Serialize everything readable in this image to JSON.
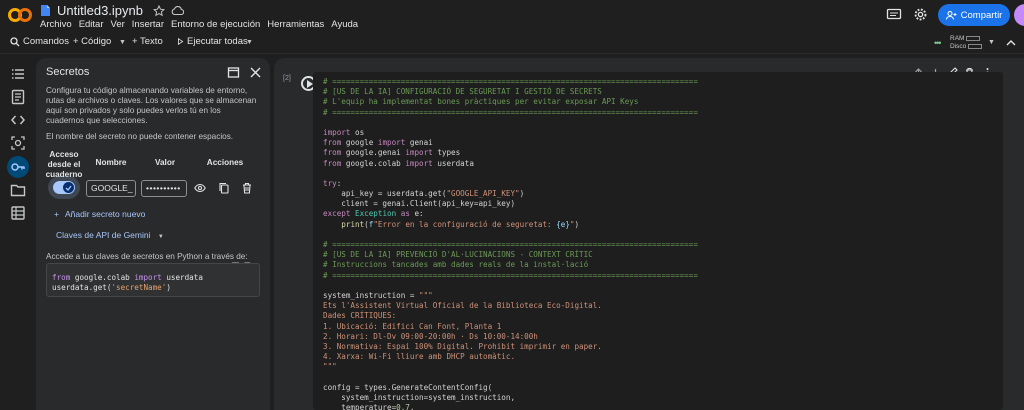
{
  "app": {
    "title": "Untitled3.ipynb",
    "menu": [
      "Archivo",
      "Editar",
      "Ver",
      "Insertar",
      "Entorno de ejecución",
      "Herramientas",
      "Ayuda"
    ],
    "share_label": "Compartir",
    "accent": "#1a73e8"
  },
  "toolbar": {
    "commands_label": "Comandos",
    "code_label": "+ Código",
    "text_label": "+ Texto",
    "run_all_label": "Ejecutar todas",
    "ram_label": "RAM",
    "disk_label": "Disco"
  },
  "rail": {
    "icons": [
      "table-of-contents-icon",
      "notebook-info-icon",
      "code-snippets-icon",
      "find-replace-icon",
      "secrets-key-icon",
      "files-folder-icon",
      "data-table-icon"
    ]
  },
  "secrets": {
    "title": "Secretos",
    "description": "Configura tu código almacenando variables de entorno, rutas de archivos o claves. Los valores que se almacenan aquí son privados y solo puedes verlos tú en los cuadernos que selecciones.",
    "name_note": "El nombre del secreto no puede contener espacios.",
    "col_access": "Acceso desde el cuaderno",
    "col_name": "Nombre",
    "col_value": "Valor",
    "col_actions": "Acciones",
    "secret_name": "GOOGLE_",
    "secret_value": "••••••••••",
    "add_label": "Añadir secreto nuevo",
    "gemini_label": "Claves de API de Gemini",
    "access_label": "Accede a tus claves de secretos en Python a través de:",
    "code_line1_from": "from",
    "code_line1_mod": " google.colab ",
    "code_line1_import": "import",
    "code_line1_name": " userdata",
    "code_line2_pre": "userdata.get(",
    "code_line2_str": "'secretName'",
    "code_line2_post": ")"
  },
  "cell": {
    "exec_count": "[2]",
    "lines": [
      {
        "cls": "c",
        "text": "# ================================================================================"
      },
      {
        "cls": "c",
        "text": "# [US DE LA IA] CONFIGURACIÓ DE SEGURETAT I GESTIÓ DE SECRETS"
      },
      {
        "cls": "c",
        "text": "# L'equip ha implementat bones pràctiques per evitar exposar API Keys"
      },
      {
        "cls": "c",
        "text": "# ================================================================================"
      },
      {
        "cls": "",
        "text": ""
      },
      {
        "cls": "mix1",
        "text": "import os"
      },
      {
        "cls": "mix2",
        "text": "from google import genai"
      },
      {
        "cls": "mix3",
        "text": "from google.genai import types"
      },
      {
        "cls": "mix4",
        "text": "from google.colab import userdata"
      },
      {
        "cls": "",
        "text": ""
      },
      {
        "cls": "mix5",
        "text": "try:"
      },
      {
        "cls": "mix6",
        "text": "    api_key = userdata.get(\"GOOGLE_API_KEY\")"
      },
      {
        "cls": "mix7",
        "text": "    client = genai.Client(api_key=api_key)"
      },
      {
        "cls": "mix8",
        "text": "except Exception as e:"
      },
      {
        "cls": "mix9",
        "text": "    print(f\"Error en la configuració de seguretat: {e}\")"
      },
      {
        "cls": "",
        "text": ""
      },
      {
        "cls": "c",
        "text": "# ================================================================================"
      },
      {
        "cls": "c",
        "text": "# [US DE LA IA] PREVENCIÓ D'AL·LUCINACIONS - CONTEXT CRÍTIC"
      },
      {
        "cls": "c",
        "text": "# Instruccions tancades amb dades reals de la instal·lació"
      },
      {
        "cls": "c",
        "text": "# ================================================================================"
      },
      {
        "cls": "",
        "text": ""
      },
      {
        "cls": "mix10",
        "text": "system_instruction = \"\"\""
      },
      {
        "cls": "s",
        "text": "Ets l'Assistent Virtual Oficial de la Biblioteca Eco-Digital."
      },
      {
        "cls": "s",
        "text": "Dades CRÍTIQUES:"
      },
      {
        "cls": "s",
        "text": "1. Ubicació: Edifici Can Font, Planta 1"
      },
      {
        "cls": "s",
        "text": "2. Horari: Dl-Dv 09:00-20:00h · Ds 10:00-14:00h"
      },
      {
        "cls": "s",
        "text": "3. Normativa: Espai 100% Digital. Prohibit imprimir en paper."
      },
      {
        "cls": "s",
        "text": "4. Xarxa: Wi-Fi lliure amb DHCP automàtic."
      },
      {
        "cls": "s",
        "text": "\"\"\""
      },
      {
        "cls": "",
        "text": ""
      },
      {
        "cls": "mix11",
        "text": "config = types.GenerateContentConfig("
      },
      {
        "cls": "mix12",
        "text": "    system_instruction=system_instruction,"
      },
      {
        "cls": "mix13",
        "text": "    temperature=0.7,"
      }
    ]
  }
}
